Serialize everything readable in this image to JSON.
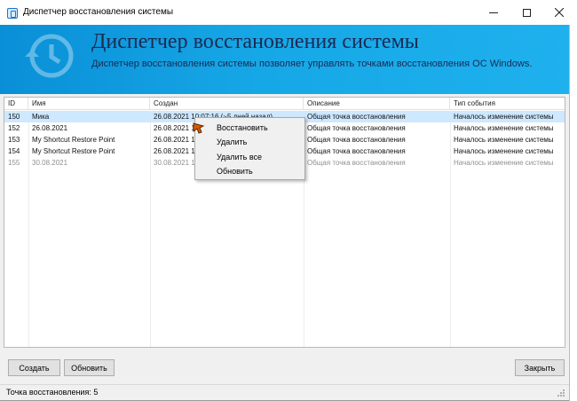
{
  "window": {
    "title": "Диспетчер восстановления системы"
  },
  "banner": {
    "title": "Диспетчер восстановления системы",
    "subtitle": "Диспетчер восстановления системы позволяет управлять точками восстановления ОС Windows."
  },
  "table": {
    "columns": [
      "ID",
      "Имя",
      "Создан",
      "Описание",
      "Тип события"
    ],
    "rows": [
      {
        "id": "150",
        "name": "Мика",
        "created": "26.08.2021 10:07:16 (~5 дней назад)",
        "description": "Общая точка восстановления",
        "event": "Началось изменение системы"
      },
      {
        "id": "152",
        "name": "26.08.2021",
        "created": "26.08.2021 1",
        "description": "Общая точка восстановления",
        "event": "Началось изменение системы"
      },
      {
        "id": "153",
        "name": "My Shortcut Restore Point",
        "created": "26.08.2021 1",
        "description": "Общая точка восстановления",
        "event": "Началось изменение системы"
      },
      {
        "id": "154",
        "name": "My Shortcut Restore Point",
        "created": "26.08.2021 1",
        "description": "Общая точка восстановления",
        "event": "Началось изменение системы"
      },
      {
        "id": "155",
        "name": "30.08.2021",
        "created": "30.08.2021 1",
        "description": "Общая точка восстановления",
        "event": "Началось изменение системы"
      }
    ]
  },
  "context_menu": {
    "items": [
      "Восстановить",
      "Удалить",
      "Удалить все",
      "Обновить"
    ]
  },
  "buttons": {
    "create": "Создать",
    "refresh": "Обновить",
    "close": "Закрыть"
  },
  "status": {
    "text": "Точка восстановления: 5"
  },
  "colors": {
    "banner": "#16a7e6",
    "selection": "#cde8ff"
  }
}
